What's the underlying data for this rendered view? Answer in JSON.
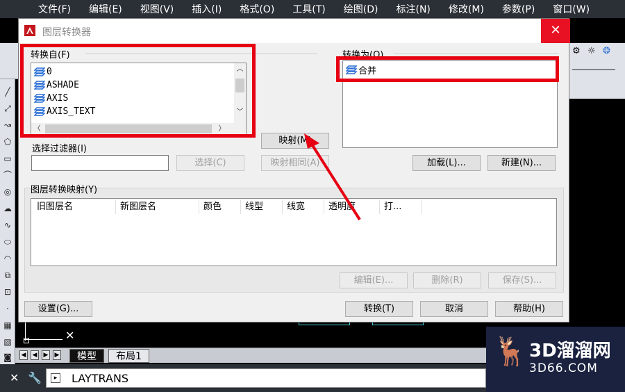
{
  "menubar": {
    "items": [
      "文件(F)",
      "编辑(E)",
      "视图(V)",
      "插入(I)",
      "格式(O)",
      "工具(T)",
      "绘图(D)",
      "标注(N)",
      "修改(M)",
      "参数(P)",
      "窗口(W)"
    ]
  },
  "dialog": {
    "title": "图层转换器",
    "close_symbol": "✕",
    "convert_from": {
      "label": "转换自(F)",
      "layers": [
        "0",
        "ASHADE",
        "AXIS",
        "AXIS_TEXT"
      ]
    },
    "filter": {
      "label": "选择过滤器(I)",
      "value": "",
      "select_button": "选择(C)"
    },
    "map_button": "映射(M)",
    "map_same_button": "映射相同(A)",
    "convert_to": {
      "label": "转换为(O)",
      "layers": [
        "合并"
      ],
      "load_button": "加载(L)...",
      "new_button": "新建(N)..."
    },
    "mappings": {
      "label": "图层转换映射(Y)",
      "columns": [
        "旧图层名",
        "新图层名",
        "颜色",
        "线型",
        "线宽",
        "透明度",
        "打..."
      ],
      "edit_button": "编辑(E)...",
      "delete_button": "删除(R)",
      "save_button": "保存(S)..."
    },
    "settings_button": "设置(G)...",
    "translate_button": "转换(T)",
    "cancel_button": "取消",
    "help_button": "帮助(H)"
  },
  "layout_tabs": {
    "tabs": [
      "模型",
      "布局1"
    ],
    "active": "模型"
  },
  "command_line": {
    "text": "LAYTRANS"
  },
  "watermark": {
    "title": "3D溜溜网",
    "domain": "3D66.COM"
  },
  "colors": {
    "annotation": "#e60012",
    "titlebar_close": "#e81123",
    "layer_icon": "#2a6fd6",
    "menubar_bg": "#2b2f36"
  }
}
